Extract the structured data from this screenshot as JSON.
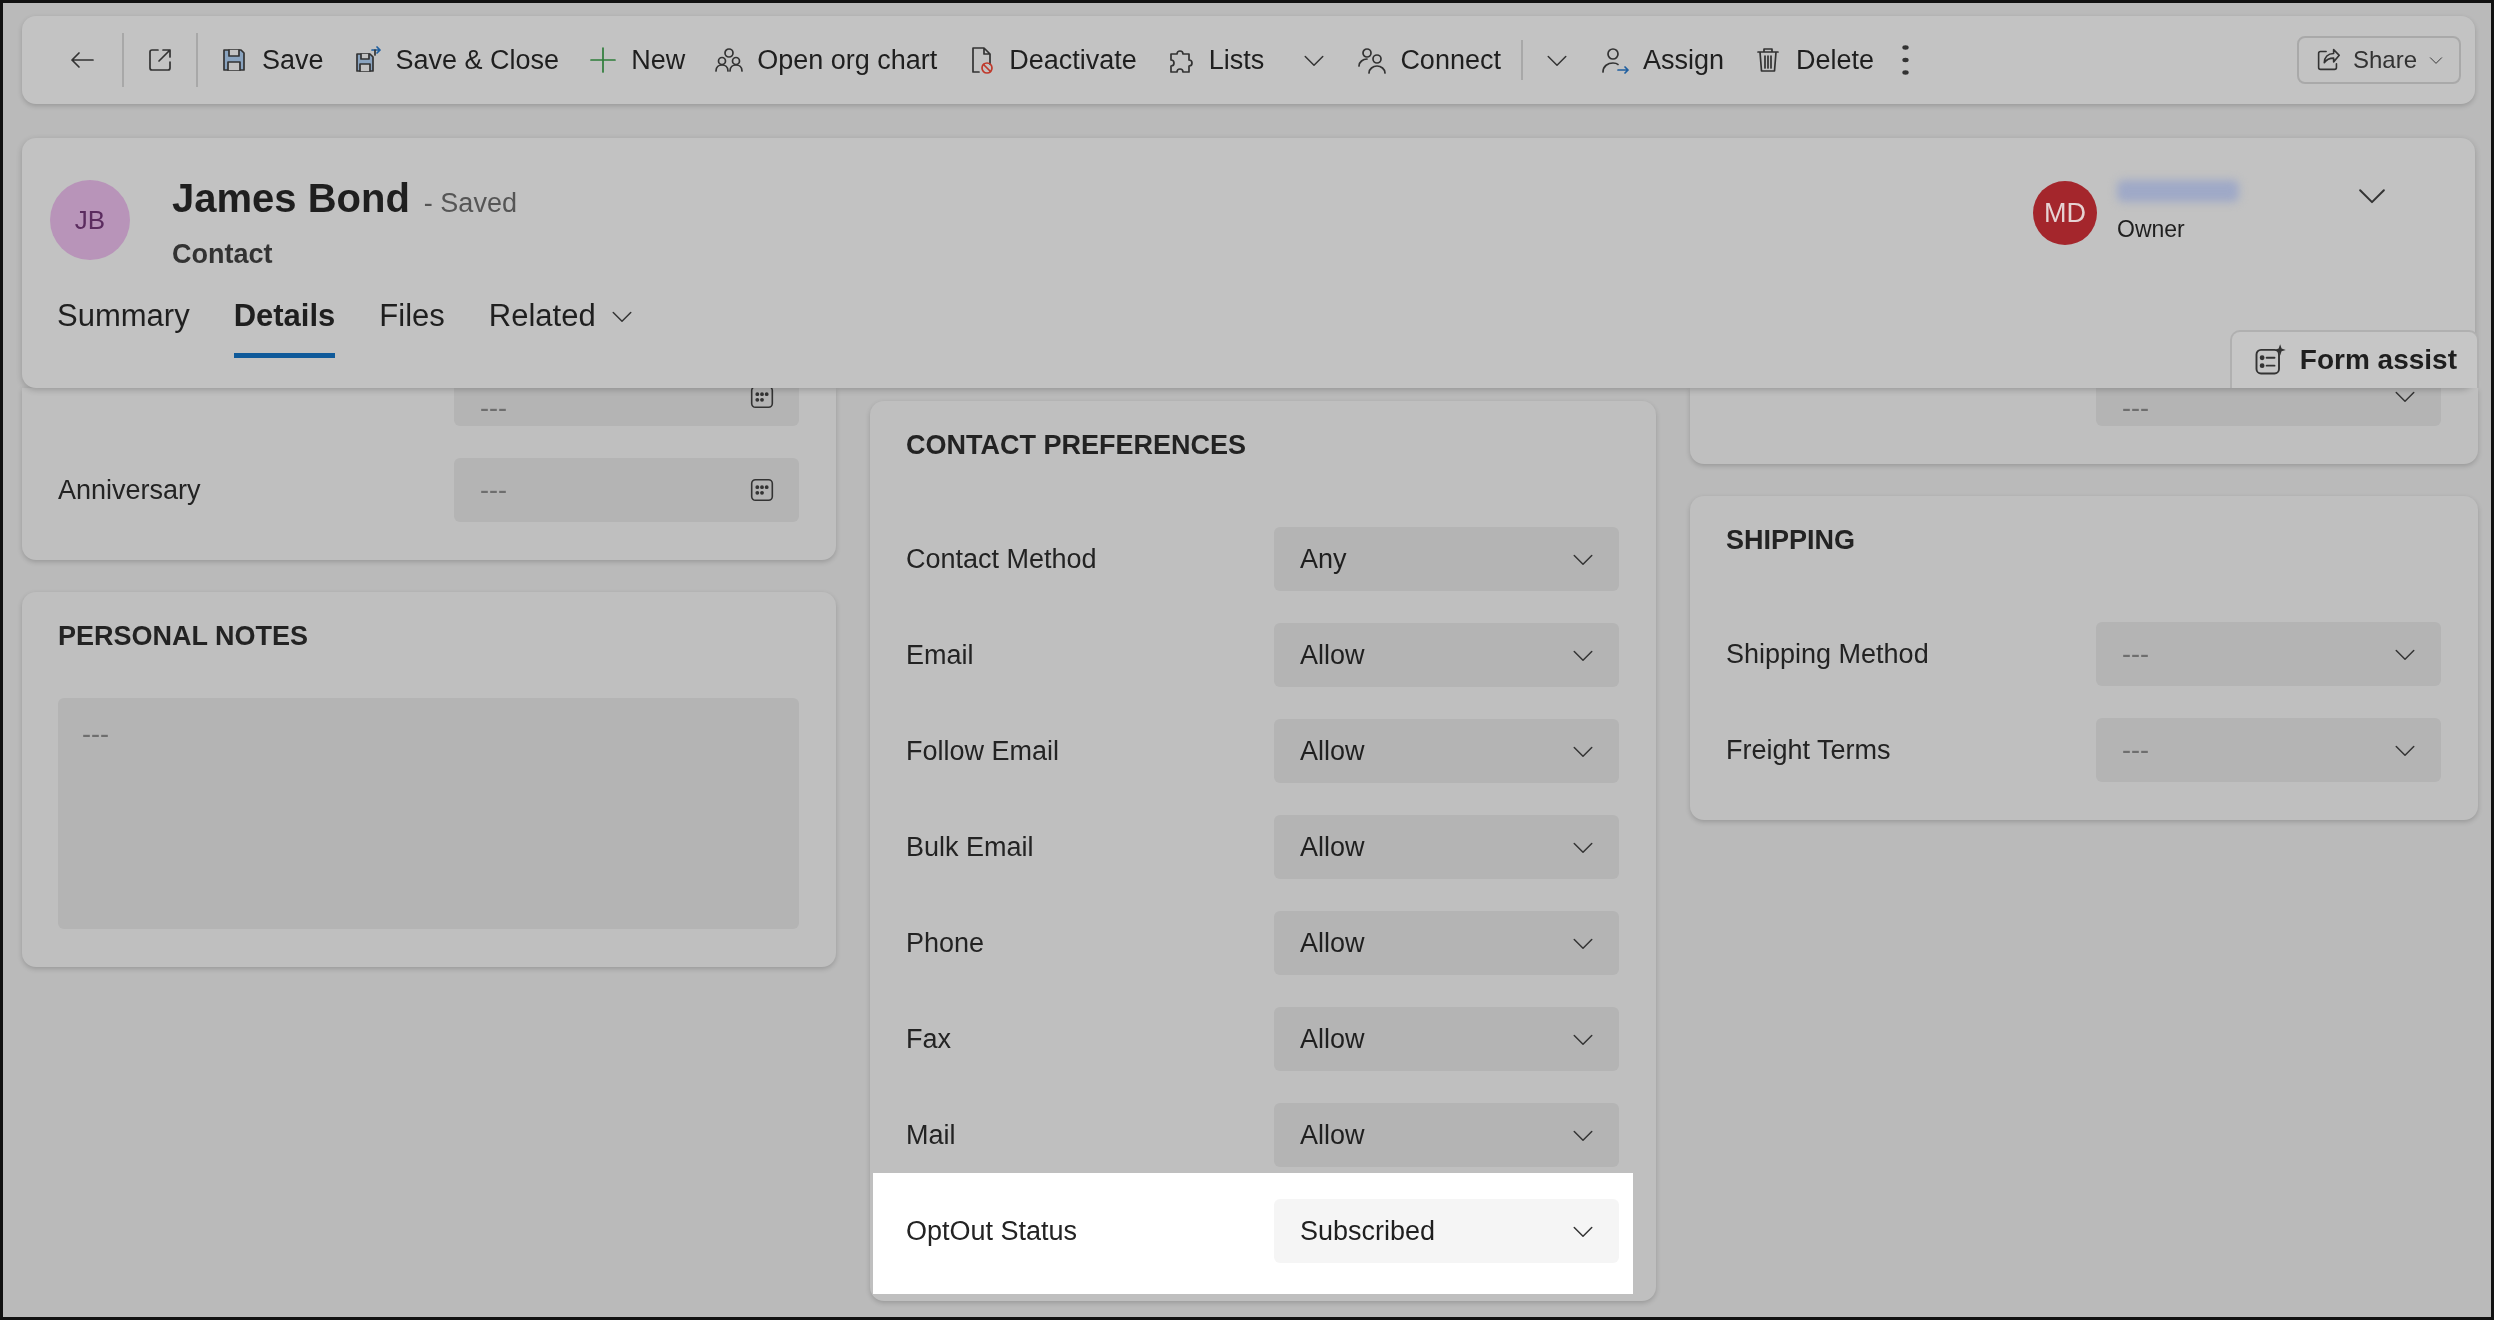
{
  "toolbar": {
    "items": [
      {
        "kind": "back"
      },
      {
        "kind": "separator"
      },
      {
        "kind": "popout"
      },
      {
        "kind": "separator"
      },
      {
        "kind": "save",
        "label": "Save",
        "dropdown": false
      },
      {
        "kind": "save_close",
        "label": "Save & Close",
        "dropdown": false
      },
      {
        "kind": "new",
        "label": "New",
        "dropdown": false
      },
      {
        "kind": "org_chart",
        "label": "Open org chart",
        "dropdown": false
      },
      {
        "kind": "deactivate",
        "label": "Deactivate",
        "dropdown": false
      },
      {
        "kind": "lists",
        "label": "Lists",
        "dropdown": true
      },
      {
        "kind": "connect",
        "label": "Connect",
        "dropdown": false
      },
      {
        "kind": "split_caret"
      },
      {
        "kind": "assign",
        "label": "Assign",
        "dropdown": false
      },
      {
        "kind": "delete",
        "label": "Delete",
        "dropdown": false
      },
      {
        "kind": "more"
      }
    ],
    "share": {
      "label": "Share"
    }
  },
  "header": {
    "avatar": {
      "initials": "JB",
      "color": "#b894b9"
    },
    "title": "James Bond",
    "status": "- Saved",
    "entity": "Contact",
    "owner": {
      "initials": "MD",
      "color": "#a4262c",
      "role": "Owner"
    },
    "tabs": [
      {
        "label": "Summary",
        "selected": false,
        "dropdown": false
      },
      {
        "label": "Details",
        "selected": true,
        "dropdown": false
      },
      {
        "label": "Files",
        "selected": false,
        "dropdown": false
      },
      {
        "label": "Related",
        "selected": false,
        "dropdown": true
      }
    ],
    "form_assist": {
      "label": "Form assist"
    }
  },
  "columns": [
    [
      {
        "kind": "fields",
        "fields": [
          {
            "placeholder": "---",
            "kind": "date",
            "highlighted": false
          },
          {
            "label": "Anniversary",
            "placeholder": "---",
            "kind": "date",
            "highlighted": false
          }
        ]
      },
      {
        "kind": "notes",
        "title": "PERSONAL NOTES",
        "placeholder": "---"
      }
    ],
    [
      {
        "kind": "fields",
        "title": "CONTACT PREFERENCES",
        "fields": [
          {
            "label": "Contact Method",
            "value": "Any",
            "kind": "select",
            "highlighted": false
          },
          {
            "label": "Email",
            "value": "Allow",
            "kind": "select",
            "highlighted": false
          },
          {
            "label": "Follow Email",
            "value": "Allow",
            "kind": "select",
            "highlighted": false
          },
          {
            "label": "Bulk Email",
            "value": "Allow",
            "kind": "select",
            "highlighted": false
          },
          {
            "label": "Phone",
            "value": "Allow",
            "kind": "select",
            "highlighted": false
          },
          {
            "label": "Fax",
            "value": "Allow",
            "kind": "select",
            "highlighted": false
          },
          {
            "label": "Mail",
            "value": "Allow",
            "kind": "select",
            "highlighted": false
          },
          {
            "label": "OptOut Status",
            "value": "Subscribed",
            "kind": "select",
            "highlighted": true
          }
        ]
      }
    ],
    [
      {
        "kind": "fields",
        "fields": [
          {
            "placeholder": "---",
            "kind": "select",
            "highlighted": false
          }
        ]
      },
      {
        "kind": "fields",
        "title": "SHIPPING",
        "fields": [
          {
            "label": "Shipping Method",
            "placeholder": "---",
            "kind": "select",
            "highlighted": false
          },
          {
            "label": "Freight Terms",
            "placeholder": "---",
            "kind": "select",
            "highlighted": false
          }
        ]
      }
    ]
  ]
}
